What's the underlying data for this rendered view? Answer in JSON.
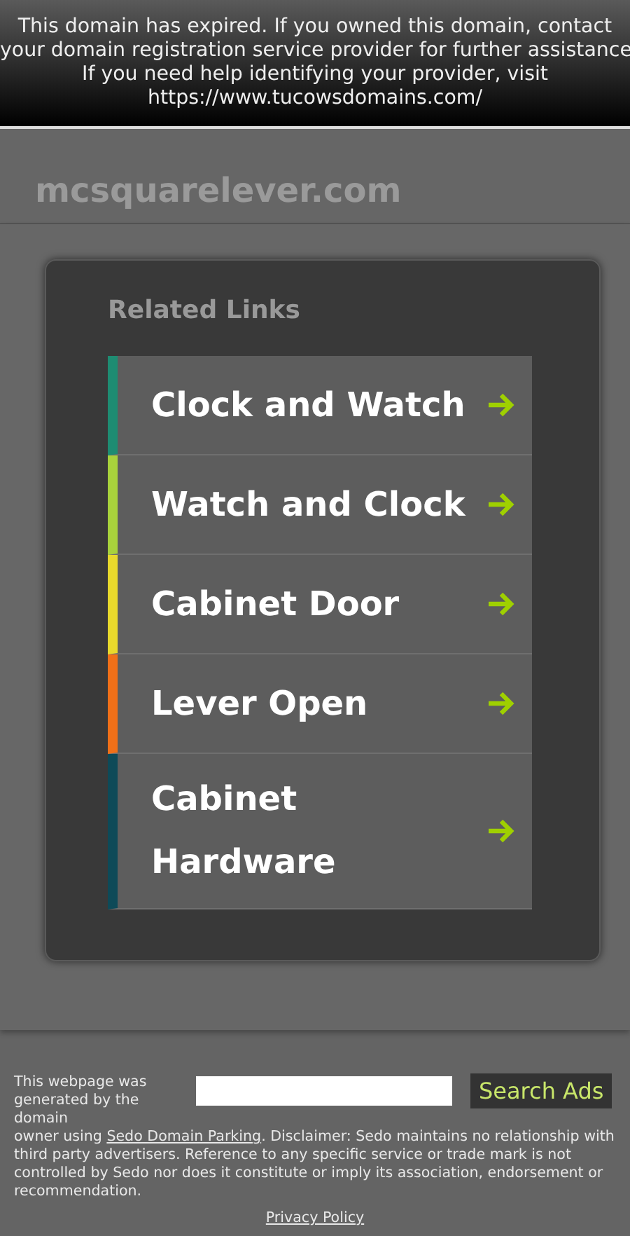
{
  "banner": {
    "lines": [
      "This domain has expired. If you owned this domain, contact",
      "your domain registration service provider for further assistance",
      "If you need help identifying your provider, visit",
      "https://www.tucowsdomains.com/"
    ]
  },
  "domain": "mcsquarelever.com",
  "related": {
    "title": "Related Links",
    "links": [
      {
        "label": "Clock and Watch",
        "color": "#1e8c72"
      },
      {
        "label": "Watch and Clock",
        "color": "#a8d23c"
      },
      {
        "label": "Cabinet Door",
        "color": "#e8d92c"
      },
      {
        "label": "Lever Open",
        "color": "#f07018"
      },
      {
        "label": "Cabinet Hardware",
        "color": "#0e4a58"
      }
    ]
  },
  "footer": {
    "intro": "This webpage was generated by the domain",
    "lead": "owner using",
    "link": "Sedo Domain Parking",
    "disclaimer": ". Disclaimer: Sedo maintains no relationship with third party advertisers. Reference to any specific service or trade mark is not controlled by Sedo nor does it constitute or imply its association, endorsement or recommendation.",
    "button": "Search Ads",
    "privacy": "Privacy Policy"
  }
}
